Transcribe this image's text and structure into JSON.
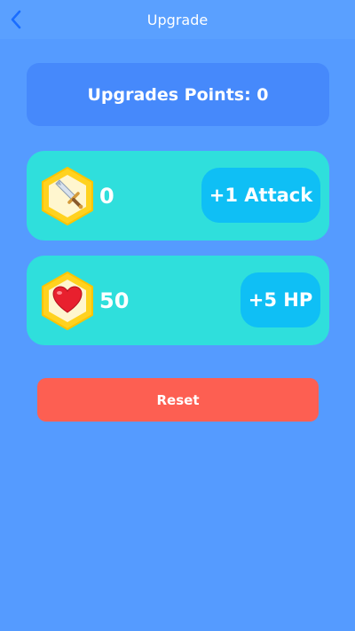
{
  "nav": {
    "title": "Upgrade",
    "back_icon": "chevron-left-icon"
  },
  "points": {
    "label": "Upgrades Points: 0"
  },
  "stats": [
    {
      "name": "attack",
      "icon": "sword-icon",
      "value": "0",
      "button_label": "+1 Attack"
    },
    {
      "name": "hp",
      "icon": "heart-icon",
      "value": "50",
      "button_label": "+5 HP"
    }
  ],
  "reset": {
    "label": "Reset"
  },
  "colors": {
    "background": "#559bff",
    "nav_bar": "#5aa0ff",
    "points_card": "#4689fb",
    "stat_card": "#2fdfdc",
    "upgrade_button": "#0fbff5",
    "reset_button": "#fd5f52",
    "hex_badge": "#ffd21f"
  }
}
